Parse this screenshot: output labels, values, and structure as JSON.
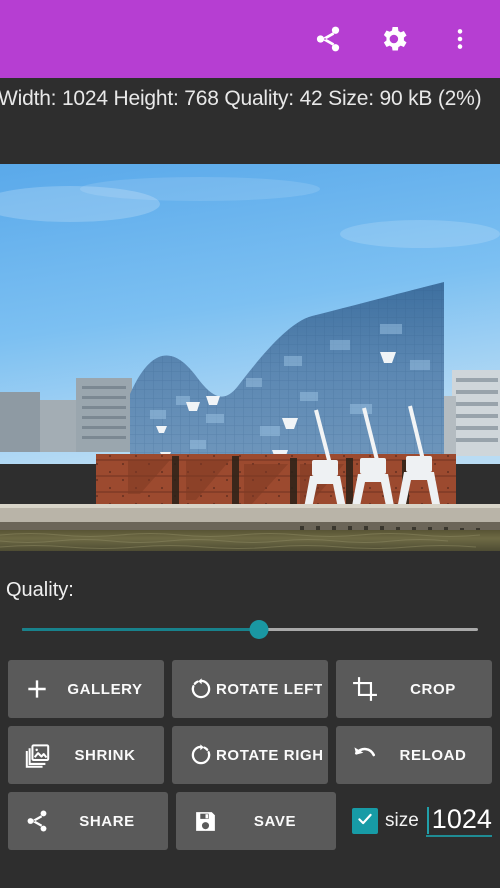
{
  "app": {
    "accent_purple": "#b63ed2",
    "background": "#2e2e2e",
    "teal": "#1a97a2",
    "button_bg": "#5a5a5a"
  },
  "appbar": {
    "share_icon": "share-icon",
    "settings_icon": "gear-icon",
    "overflow_icon": "more-vertical-icon"
  },
  "infobar": {
    "text": "Width: 1024 Height: 768 Quality: 42 Size: 90 kB (2%)",
    "width_label": "Width:",
    "width_value": "1024",
    "height_label": "Height:",
    "height_value": "768",
    "quality_label": "Quality:",
    "quality_value": "42",
    "size_label": "Size:",
    "size_value": "90 kB",
    "size_percent": "(2%)"
  },
  "photo": {
    "alt": "Elbphilharmonie concert hall in Hamburg seen from the Elbe river",
    "sky_color": "#6fb7ef",
    "glass_color": "#4d7ca8",
    "brick_color": "#9e4a30",
    "water_color": "#6d6a46"
  },
  "controls": {
    "quality_label": "Quality:",
    "slider": {
      "value": 42,
      "min": 0,
      "max": 100,
      "fill_percent": 52,
      "thumb_icon": "slider-thumb"
    }
  },
  "buttons": [
    [
      {
        "label": "GALLERY",
        "icon": "plus-icon"
      },
      {
        "label": "ROTATE LEFT",
        "icon": "rotate-left-icon"
      },
      {
        "label": "CROP",
        "icon": "crop-icon"
      }
    ],
    [
      {
        "label": "SHRINK",
        "icon": "images-icon"
      },
      {
        "label": "ROTATE RIGHT",
        "icon": "rotate-right-icon"
      },
      {
        "label": "RELOAD",
        "icon": "undo-arrow-icon"
      }
    ],
    [
      {
        "label": "SHARE",
        "icon": "share-icon"
      },
      {
        "label": "SAVE",
        "icon": "floppy-disk-icon"
      }
    ]
  ],
  "size_field": {
    "checked": true,
    "checkbox_icon": "checkmark-icon",
    "label": "size",
    "value": "1024"
  }
}
